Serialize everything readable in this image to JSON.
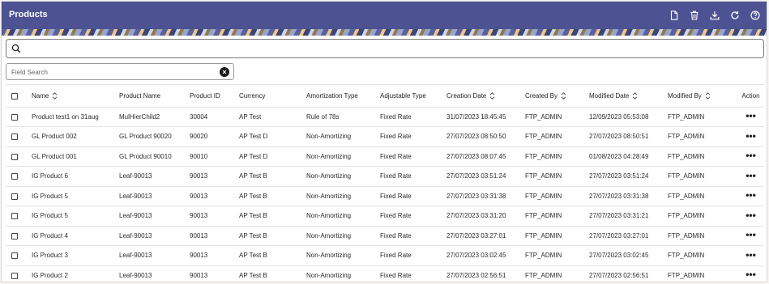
{
  "header": {
    "title": "Products",
    "actions": [
      {
        "name": "new-document-icon"
      },
      {
        "name": "trash-icon"
      },
      {
        "name": "download-icon"
      },
      {
        "name": "refresh-icon"
      },
      {
        "name": "help-icon"
      }
    ]
  },
  "search": {
    "value": ""
  },
  "field_search": {
    "placeholder": "Field Search"
  },
  "table": {
    "headers": {
      "name": "Name",
      "product_name": "Product Name",
      "product_id": "Product ID",
      "currency": "Currency",
      "amortization_type": "Amortization Type",
      "adjustable_type": "Adjustable Type",
      "creation_date": "Creation Date",
      "created_by": "Created By",
      "modified_date": "Modified Date",
      "modified_by": "Modified By",
      "action": "Action"
    },
    "rows": [
      {
        "name": "Product test1 on 31aug",
        "product_name": "MulHierChild2",
        "product_id": "30004",
        "currency": "AP Test",
        "amortization_type": "Rule of 78s",
        "adjustable_type": "Fixed Rate",
        "creation_date": "31/07/2023 18:45:45",
        "created_by": "FTP_ADMIN",
        "modified_date": "12/09/2023 05:53:08",
        "modified_by": "FTP_ADMIN",
        "action": "•••"
      },
      {
        "name": "GL Product 002",
        "product_name": "GL Product 90020",
        "product_id": "90020",
        "currency": "AP Test D",
        "amortization_type": "Non-Amortizing",
        "adjustable_type": "Fixed Rate",
        "creation_date": "27/07/2023 08:50:50",
        "created_by": "FTP_ADMIN",
        "modified_date": "27/07/2023 08:50:51",
        "modified_by": "FTP_ADMIN",
        "action": "•••"
      },
      {
        "name": "GL Product 001",
        "product_name": "GL Product 90010",
        "product_id": "90010",
        "currency": "AP Test D",
        "amortization_type": "Non-Amortizing",
        "adjustable_type": "Fixed Rate",
        "creation_date": "27/07/2023 08:07:45",
        "created_by": "FTP_ADMIN",
        "modified_date": "01/08/2023 04:28:49",
        "modified_by": "FTP_ADMIN",
        "action": "•••"
      },
      {
        "name": "IG Product 6",
        "product_name": "Leaf-90013",
        "product_id": "90013",
        "currency": "AP Test B",
        "amortization_type": "Non-Amortizing",
        "adjustable_type": "Fixed Rate",
        "creation_date": "27/07/2023 03:51:24",
        "created_by": "FTP_ADMIN",
        "modified_date": "27/07/2023 03:51:24",
        "modified_by": "FTP_ADMIN",
        "action": "•••"
      },
      {
        "name": "IG Product 5",
        "product_name": "Leaf-90013",
        "product_id": "90013",
        "currency": "AP Test B",
        "amortization_type": "Non-Amortizing",
        "adjustable_type": "Fixed Rate",
        "creation_date": "27/07/2023 03:31:38",
        "created_by": "FTP_ADMIN",
        "modified_date": "27/07/2023 03:31:38",
        "modified_by": "FTP_ADMIN",
        "action": "•••"
      },
      {
        "name": "IG Product 5",
        "product_name": "Leaf-90013",
        "product_id": "90013",
        "currency": "AP Test B",
        "amortization_type": "Non-Amortizing",
        "adjustable_type": "Fixed Rate",
        "creation_date": "27/07/2023 03:31:20",
        "created_by": "FTP_ADMIN",
        "modified_date": "27/07/2023 03:31:21",
        "modified_by": "FTP_ADMIN",
        "action": "•••"
      },
      {
        "name": "IG Product 4",
        "product_name": "Leaf-90013",
        "product_id": "90013",
        "currency": "AP Test B",
        "amortization_type": "Non-Amortizing",
        "adjustable_type": "Fixed Rate",
        "creation_date": "27/07/2023 03:27:01",
        "created_by": "FTP_ADMIN",
        "modified_date": "27/07/2023 03:27:01",
        "modified_by": "FTP_ADMIN",
        "action": "•••"
      },
      {
        "name": "IG Product 3",
        "product_name": "Leaf-90013",
        "product_id": "90013",
        "currency": "AP Test B",
        "amortization_type": "Non-Amortizing",
        "adjustable_type": "Fixed Rate",
        "creation_date": "27/07/2023 03:02:45",
        "created_by": "FTP_ADMIN",
        "modified_date": "27/07/2023 03:02:45",
        "modified_by": "FTP_ADMIN",
        "action": "•••"
      },
      {
        "name": "IG Product 2",
        "product_name": "Leaf-90013",
        "product_id": "90013",
        "currency": "AP Test B",
        "amortization_type": "Non-Amortizing",
        "adjustable_type": "Fixed Rate",
        "creation_date": "27/07/2023 02:56:51",
        "created_by": "FTP_ADMIN",
        "modified_date": "27/07/2023 02:56:51",
        "modified_by": "FTP_ADMIN",
        "action": "•••"
      }
    ]
  },
  "colors": {
    "header_bg": "#4c5292",
    "header_text": "#ffffff"
  }
}
